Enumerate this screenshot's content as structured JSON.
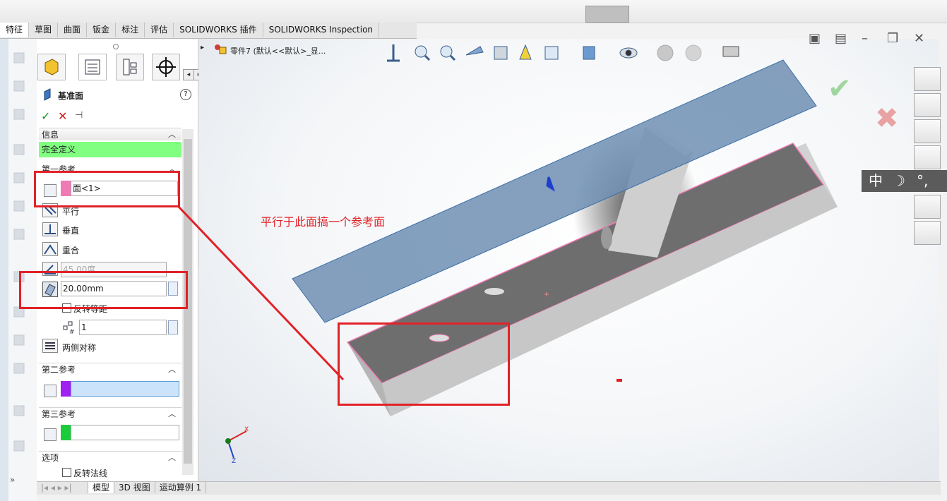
{
  "tabs": [
    "特征",
    "草图",
    "曲面",
    "钣金",
    "标注",
    "评估",
    "SOLIDWORKS 插件",
    "SOLIDWORKS Inspection"
  ],
  "active_tab_index": 0,
  "tree": {
    "part_name": "零件7 (默认<<默认>_显..."
  },
  "pm": {
    "title": "基准面",
    "help": "?",
    "ok": "✓",
    "cancel": "✕",
    "pin": "⊣",
    "sections": {
      "info": "信息",
      "first_ref": "第一参考",
      "second_ref": "第二参考",
      "third_ref": "第三参考",
      "options": "选项"
    },
    "status": "完全定义",
    "first_ref_value": "面<1>",
    "parallel": "平行",
    "perpendicular": "垂直",
    "coincident": "重合",
    "angle_value": "45.00度",
    "distance_value": "20.00mm",
    "flip_offset": "反转等距",
    "count_value": "1",
    "mid_plane": "两侧对称",
    "flip_normal": "反转法线"
  },
  "colors": {
    "first_ref_swatch": "#f07ab4",
    "second_ref_swatch": "#a020f0",
    "third_ref_swatch": "#1bcc3a",
    "status_bg": "#80ff80",
    "annotation": "#e12228",
    "plane_fill": "#6f8fb3"
  },
  "annotation_text": "平行于此面搞一个参考面",
  "bottom_tabs": [
    "模型",
    "3D 视图",
    "运动算例 1"
  ],
  "active_bottom_tab": 0,
  "ime": {
    "mode": "中",
    "moon": "☽",
    "punct": "°,"
  },
  "axis": {
    "x": "X",
    "z": "Z"
  },
  "confirm": {
    "ok": "✔",
    "cancel": "✖"
  }
}
